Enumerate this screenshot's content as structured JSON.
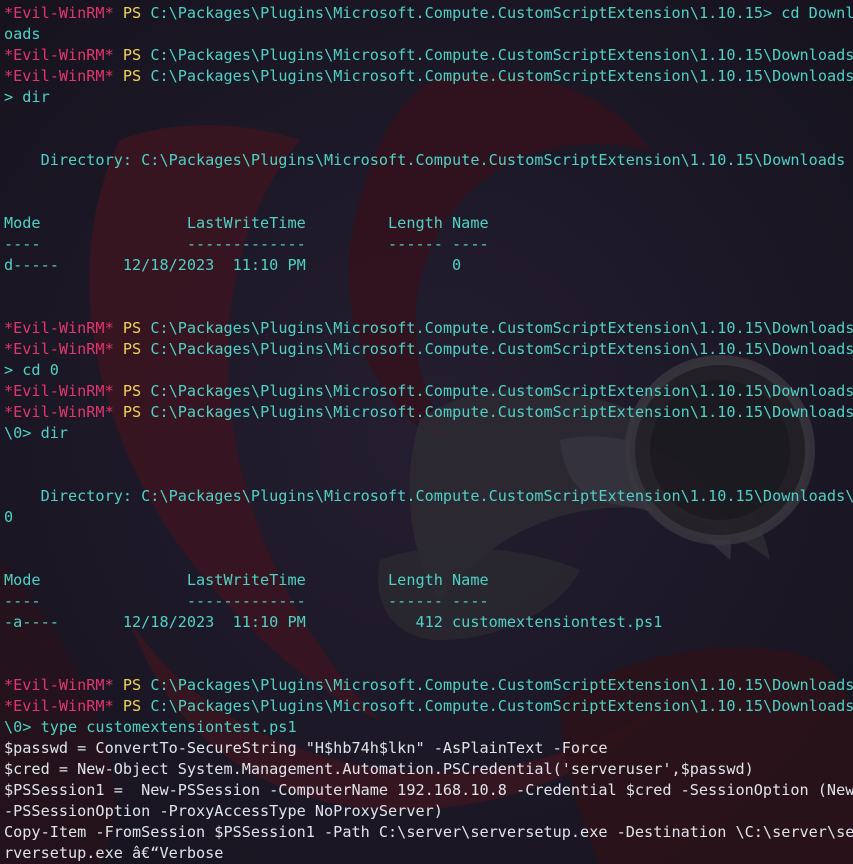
{
  "prompt": {
    "evil": "*Evil-WinRM*",
    "ps": "PS"
  },
  "lines": [
    {
      "type": "prompt",
      "path": "C:\\Packages\\Plugins\\Microsoft.Compute.CustomScriptExtension\\1.10.15> cd Downl"
    },
    {
      "type": "output",
      "text": "oads"
    },
    {
      "type": "prompt",
      "path": "C:\\Packages\\Plugins\\Microsoft.Compute.CustomScriptExtension\\1.10.15\\Downloads"
    },
    {
      "type": "prompt",
      "path": "C:\\Packages\\Plugins\\Microsoft.Compute.CustomScriptExtension\\1.10.15\\Downloads"
    },
    {
      "type": "output",
      "text": "> dir"
    },
    {
      "type": "output",
      "text": ""
    },
    {
      "type": "output",
      "text": ""
    },
    {
      "type": "output",
      "text": "    Directory: C:\\Packages\\Plugins\\Microsoft.Compute.CustomScriptExtension\\1.10.15\\Downloads"
    },
    {
      "type": "output",
      "text": ""
    },
    {
      "type": "output",
      "text": ""
    },
    {
      "type": "output",
      "text": "Mode                LastWriteTime         Length Name"
    },
    {
      "type": "output",
      "text": "----                -------------         ------ ----"
    },
    {
      "type": "output",
      "text": "d-----       12/18/2023  11:10 PM                0"
    },
    {
      "type": "output",
      "text": ""
    },
    {
      "type": "output",
      "text": ""
    },
    {
      "type": "prompt",
      "path": "C:\\Packages\\Plugins\\Microsoft.Compute.CustomScriptExtension\\1.10.15\\Downloads"
    },
    {
      "type": "prompt",
      "path": "C:\\Packages\\Plugins\\Microsoft.Compute.CustomScriptExtension\\1.10.15\\Downloads"
    },
    {
      "type": "output",
      "text": "> cd 0"
    },
    {
      "type": "prompt",
      "path": "C:\\Packages\\Plugins\\Microsoft.Compute.CustomScriptExtension\\1.10.15\\Downloads"
    },
    {
      "type": "prompt",
      "path": "C:\\Packages\\Plugins\\Microsoft.Compute.CustomScriptExtension\\1.10.15\\Downloads"
    },
    {
      "type": "output",
      "text": "\\0> dir"
    },
    {
      "type": "output",
      "text": ""
    },
    {
      "type": "output",
      "text": ""
    },
    {
      "type": "output",
      "text": "    Directory: C:\\Packages\\Plugins\\Microsoft.Compute.CustomScriptExtension\\1.10.15\\Downloads\\"
    },
    {
      "type": "output",
      "text": "0"
    },
    {
      "type": "output",
      "text": ""
    },
    {
      "type": "output",
      "text": ""
    },
    {
      "type": "output",
      "text": "Mode                LastWriteTime         Length Name"
    },
    {
      "type": "output",
      "text": "----                -------------         ------ ----"
    },
    {
      "type": "output",
      "text": "-a----       12/18/2023  11:10 PM            412 customextensiontest.ps1"
    },
    {
      "type": "output",
      "text": ""
    },
    {
      "type": "output",
      "text": ""
    },
    {
      "type": "prompt",
      "path": "C:\\Packages\\Plugins\\Microsoft.Compute.CustomScriptExtension\\1.10.15\\Downloads"
    },
    {
      "type": "prompt",
      "path": "C:\\Packages\\Plugins\\Microsoft.Compute.CustomScriptExtension\\1.10.15\\Downloads"
    },
    {
      "type": "output",
      "text": "\\0> type customextensiontest.ps1"
    },
    {
      "type": "white",
      "text": "$passwd = ConvertTo-SecureString \"H$hb74h$lkn\" -AsPlainText -Force"
    },
    {
      "type": "white",
      "text": "$cred = New-Object System.Management.Automation.PSCredential('serveruser',$passwd)"
    },
    {
      "type": "white",
      "text": "$PSSession1 =  New-PSSession -ComputerName 192.168.10.8 -Credential $cred -SessionOption (New"
    },
    {
      "type": "white",
      "text": "-PSSessionOption -ProxyAccessType NoProxyServer)"
    },
    {
      "type": "white",
      "text": "Copy-Item -FromSession $PSSession1 -Path C:\\server\\serversetup.exe -Destination \\C:\\server\\se"
    },
    {
      "type": "white",
      "text": "rversetup.exe â€“Verbose"
    }
  ]
}
